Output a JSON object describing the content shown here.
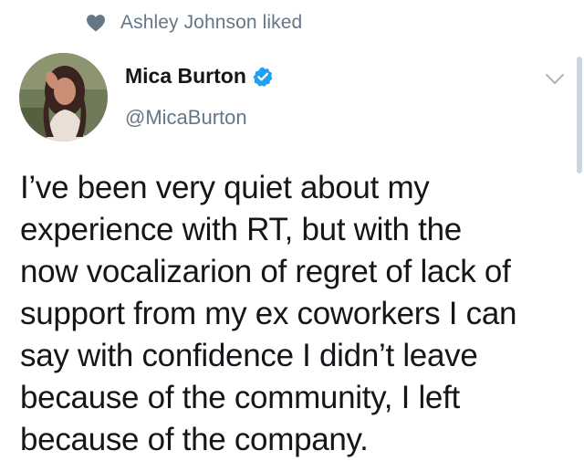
{
  "social_context": {
    "icon": "heart-icon",
    "text": "Ashley Johnson liked"
  },
  "author": {
    "name": "Mica Burton",
    "handle": "@MicaBurton",
    "verified": true,
    "verified_color": "#1da1f2"
  },
  "caret": {
    "icon": "chevron-down-icon"
  },
  "tweet": {
    "lines": [
      "I’ve been very quiet about my",
      "experience with RT, but with the",
      "now vocalizarion of regret of lack of",
      "support from my ex coworkers I can",
      "say with confidence I didn’t leave",
      "because of the community, I left",
      "because of the company."
    ]
  },
  "colors": {
    "text_primary": "#14171a",
    "text_secondary": "#657786",
    "accent": "#1da1f2"
  }
}
